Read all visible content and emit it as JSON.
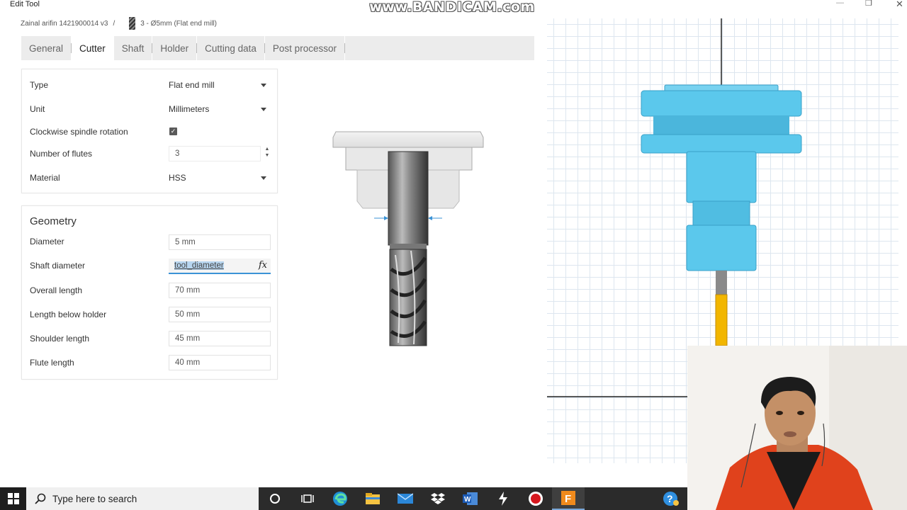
{
  "window": {
    "title": "Edit Tool"
  },
  "watermark": "www.BANDICAM.com",
  "breadcrumb": {
    "project": "Zainal arifin 1421900014 v3",
    "separator": "/",
    "tool": "3 - Ø5mm (Flat end mill)"
  },
  "tabs": [
    {
      "label": "General"
    },
    {
      "label": "Cutter",
      "active": true
    },
    {
      "label": "Shaft"
    },
    {
      "label": "Holder"
    },
    {
      "label": "Cutting data"
    },
    {
      "label": "Post processor"
    }
  ],
  "cutter": {
    "type_label": "Type",
    "type_value": "Flat end mill",
    "unit_label": "Unit",
    "unit_value": "Millimeters",
    "spindle_label": "Clockwise spindle rotation",
    "spindle_checked": true,
    "flutes_label": "Number of flutes",
    "flutes_value": "3",
    "material_label": "Material",
    "material_value": "HSS"
  },
  "geometry": {
    "title": "Geometry",
    "diameter_label": "Diameter",
    "diameter_value": "5 mm",
    "shaft_label": "Shaft diameter",
    "shaft_value": "tool_diameter",
    "shaft_fx": "fx",
    "overall_label": "Overall length",
    "overall_value": "70 mm",
    "below_label": "Length below holder",
    "below_value": "50 mm",
    "shoulder_label": "Shoulder length",
    "shoulder_value": "45 mm",
    "flute_label": "Flute length",
    "flute_value": "40 mm"
  },
  "taskbar": {
    "search_placeholder": "Type here to search"
  },
  "colors": {
    "holder_3d": "#5bc8ec",
    "tool_3d": "#f2b600",
    "tab_bar": "#ececec"
  },
  "icons": [
    "windows-start-icon",
    "search-icon",
    "cortana-icon",
    "task-view-icon",
    "edge-icon",
    "file-explorer-icon",
    "mail-icon",
    "dropbox-icon",
    "word-icon",
    "app-icon",
    "record-icon",
    "fusion360-icon",
    "help-icon"
  ]
}
